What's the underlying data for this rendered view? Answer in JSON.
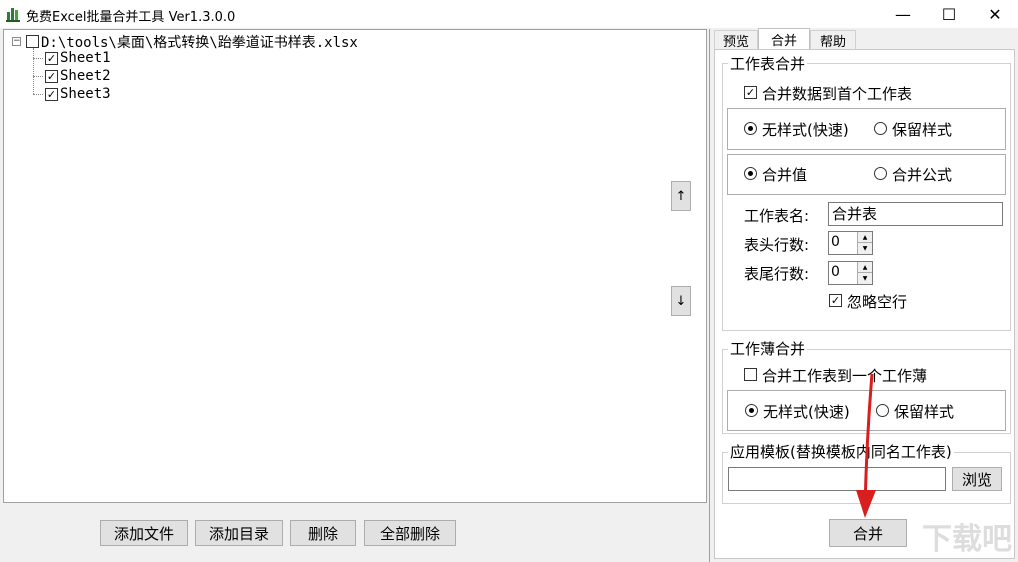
{
  "window": {
    "title": "免费Excel批量合并工具 Ver1.3.0.0",
    "minimize": "—",
    "maximize": "☐",
    "close": "✕"
  },
  "tree": {
    "root": "D:\\tools\\桌面\\格式转换\\跆拳道证书样表.xlsx",
    "expander": "−",
    "root_checked": false,
    "sheets": [
      {
        "label": "Sheet1",
        "checked": true
      },
      {
        "label": "Sheet2",
        "checked": true
      },
      {
        "label": "Sheet3",
        "checked": true
      }
    ]
  },
  "move": {
    "up": "↑",
    "down": "↓"
  },
  "bottom_buttons": {
    "add_file": "添加文件",
    "add_dir": "添加目录",
    "delete": "删除",
    "delete_all": "全部删除"
  },
  "tabs": [
    "预览",
    "合并",
    "帮助"
  ],
  "active_tab": "合并",
  "sheet_merge": {
    "title": "工作表合并",
    "merge_to_first": "合并数据到首个工作表",
    "merge_to_first_checked": true,
    "style_no": "无样式(快速)",
    "style_keep": "保留样式",
    "style_selected": "无样式(快速)",
    "val_merge": "合并值",
    "val_formula": "合并公式",
    "val_selected": "合并值",
    "sheet_name_label": "工作表名:",
    "sheet_name_value": "合并表",
    "header_rows_label": "表头行数:",
    "header_rows_value": "0",
    "footer_rows_label": "表尾行数:",
    "footer_rows_value": "0",
    "ignore_blank": "忽略空行",
    "ignore_blank_checked": true
  },
  "book_merge": {
    "title": "工作薄合并",
    "merge_to_one": "合并工作表到一个工作薄",
    "merge_to_one_checked": false,
    "style_no": "无样式(快速)",
    "style_keep": "保留样式",
    "style_selected": "无样式(快速)"
  },
  "template": {
    "title": "应用模板(替换模板内同名工作表)",
    "path_value": "",
    "browse": "浏览"
  },
  "merge_button": "合并",
  "colors": {
    "arrow": "#d81e1e",
    "accent_icon": "#2e7d32"
  }
}
